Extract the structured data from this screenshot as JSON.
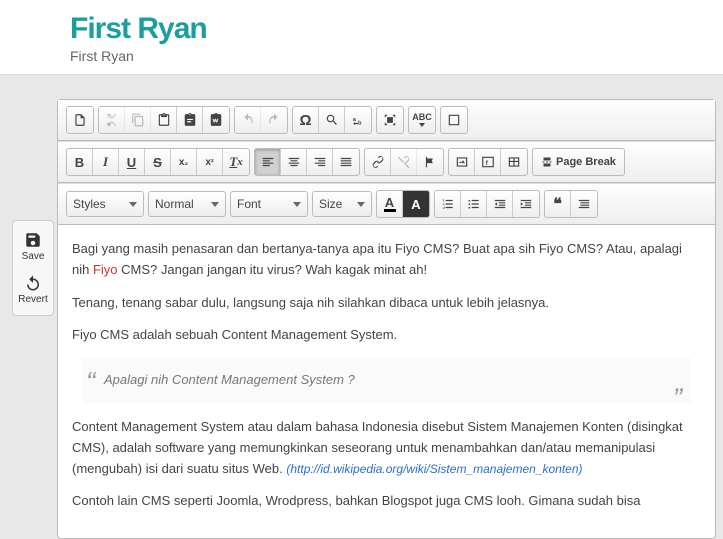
{
  "header": {
    "title": "First Ryan",
    "tagline": "First Ryan"
  },
  "sidebar": {
    "save": "Save",
    "revert": "Revert"
  },
  "toolbar": {
    "styles": "Styles",
    "format": "Normal",
    "font": "Font",
    "size": "Size",
    "pagebreak": "Page Break"
  },
  "content": {
    "p1a": "Bagi yang masih penasaran dan bertanya-tanya apa itu Fiyo CMS? Buat apa sih Fiyo CMS? Atau, apalagi nih ",
    "p1b": "Fiyo",
    "p1c": " CMS? Jangan jangan itu virus? Wah kagak minat ah!",
    "p2": "Tenang, tenang sabar dulu, langsung saja nih silahkan dibaca untuk lebih jelasnya.",
    "p3": "Fiyo CMS adalah sebuah Content Management System.",
    "quote": "Apalagi nih Content Management System ?",
    "p4a": "Content Management System atau dalam bahasa Indonesia disebut Sistem Manajemen Konten (disingkat CMS), adalah software yang memungkinkan seseorang untuk menambahkan dan/atau memanipulasi (mengubah) isi dari suatu situs Web. ",
    "p4link": "(http://id.wikipedia.org/wiki/Sistem_manajemen_konten)",
    "p5": "Contoh lain CMS seperti Joomla, Wrodpress, bahkan Blogspot juga CMS looh. Gimana sudah bisa"
  }
}
